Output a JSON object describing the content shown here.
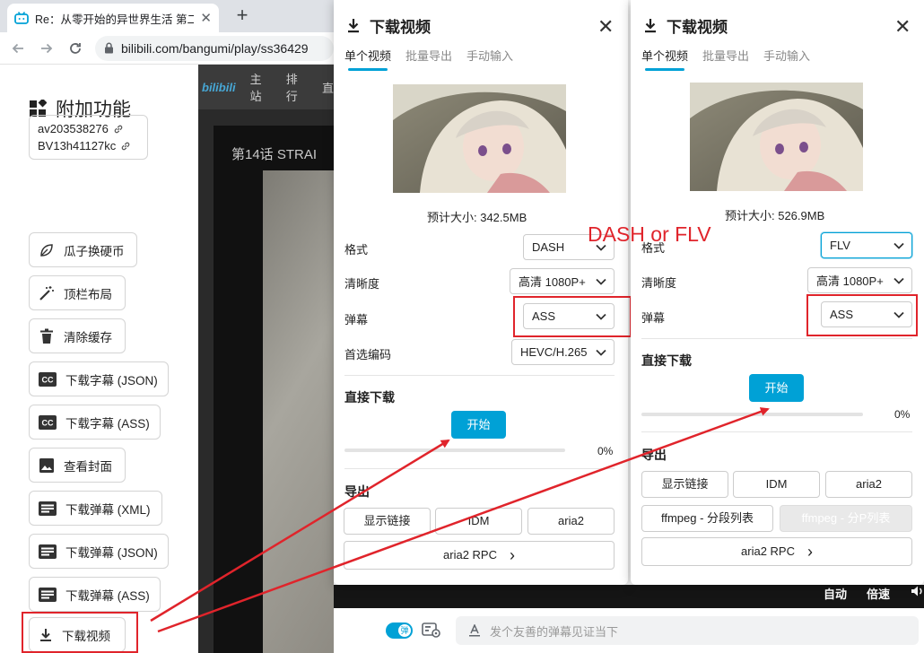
{
  "browser": {
    "tab_title": "Re：从零开始的异世界生活 第二",
    "tab_close": "✕",
    "new_tab": "+",
    "url": "bilibili.com/bangumi/play/ss36429"
  },
  "sidebar": {
    "title": "附加功能",
    "av_id": "av203538276",
    "bv_id": "BV13h41127kc",
    "items": [
      {
        "label": "瓜子换硬币",
        "icon": "leaf-icon"
      },
      {
        "label": "顶栏布局",
        "icon": "magic-wand-icon"
      },
      {
        "label": "清除缓存",
        "icon": "trash-icon"
      },
      {
        "label": "下载字幕 (JSON)",
        "icon": "closed-caption-icon"
      },
      {
        "label": "下载字幕 (ASS)",
        "icon": "closed-caption-icon"
      },
      {
        "label": "查看封面",
        "icon": "image-icon"
      },
      {
        "label": "下载弹幕 (XML)",
        "icon": "list-icon"
      },
      {
        "label": "下载弹幕 (JSON)",
        "icon": "list-icon"
      },
      {
        "label": "下载弹幕 (ASS)",
        "icon": "list-icon"
      },
      {
        "label": "下载视频",
        "icon": "download-icon"
      }
    ]
  },
  "video": {
    "logo": "bilibili",
    "nav_main": "主站",
    "nav_rank": "排行",
    "nav_more": "直",
    "episode_title": "第14话   STRAI",
    "auto_label": "自动",
    "speed_label": "倍速",
    "toggle_char": "弹",
    "danmaku_placeholder": "发个友善的弹幕见证当下"
  },
  "panel_left": {
    "title": "下载视频",
    "close": "✕",
    "tabs": [
      "单个视频",
      "批量导出",
      "手动输入"
    ],
    "estimate": "预计大小: 342.5MB",
    "format_label": "格式",
    "format_value": "DASH",
    "quality_label": "清晰度",
    "quality_value": "高清 1080P+",
    "danmaku_label": "弹幕",
    "danmaku_value": "ASS",
    "codec_label": "首选编码",
    "codec_value": "HEVC/H.265",
    "direct_title": "直接下载",
    "start_label": "开始",
    "progress": 0,
    "progress_text": "0%",
    "export_title": "导出",
    "export_buttons": [
      "显示链接",
      "IDM",
      "aria2"
    ],
    "rpc_label": "aria2 RPC",
    "rpc_arrow": "›"
  },
  "panel_right": {
    "title": "下载视频",
    "close": "✕",
    "tabs": [
      "单个视频",
      "批量导出",
      "手动输入"
    ],
    "estimate": "预计大小: 526.9MB",
    "format_label": "格式",
    "format_value": "FLV",
    "quality_label": "清晰度",
    "quality_value": "高清 1080P+",
    "danmaku_label": "弹幕",
    "danmaku_value": "ASS",
    "direct_title": "直接下载",
    "start_label": "开始",
    "progress": 0,
    "progress_text": "0%",
    "export_title": "导出",
    "export_buttons": [
      "显示链接",
      "IDM",
      "aria2"
    ],
    "ffmpeg_segment": "ffmpeg - 分段列表",
    "ffmpeg_p": "ffmpeg - 分P列表",
    "rpc_label": "aria2 RPC",
    "rpc_arrow": "›"
  },
  "annotation": {
    "text": "DASH or FLV",
    "color": "#e0242b"
  },
  "colors": {
    "accent": "#00a1d6",
    "annotation_red": "#e0242b"
  }
}
